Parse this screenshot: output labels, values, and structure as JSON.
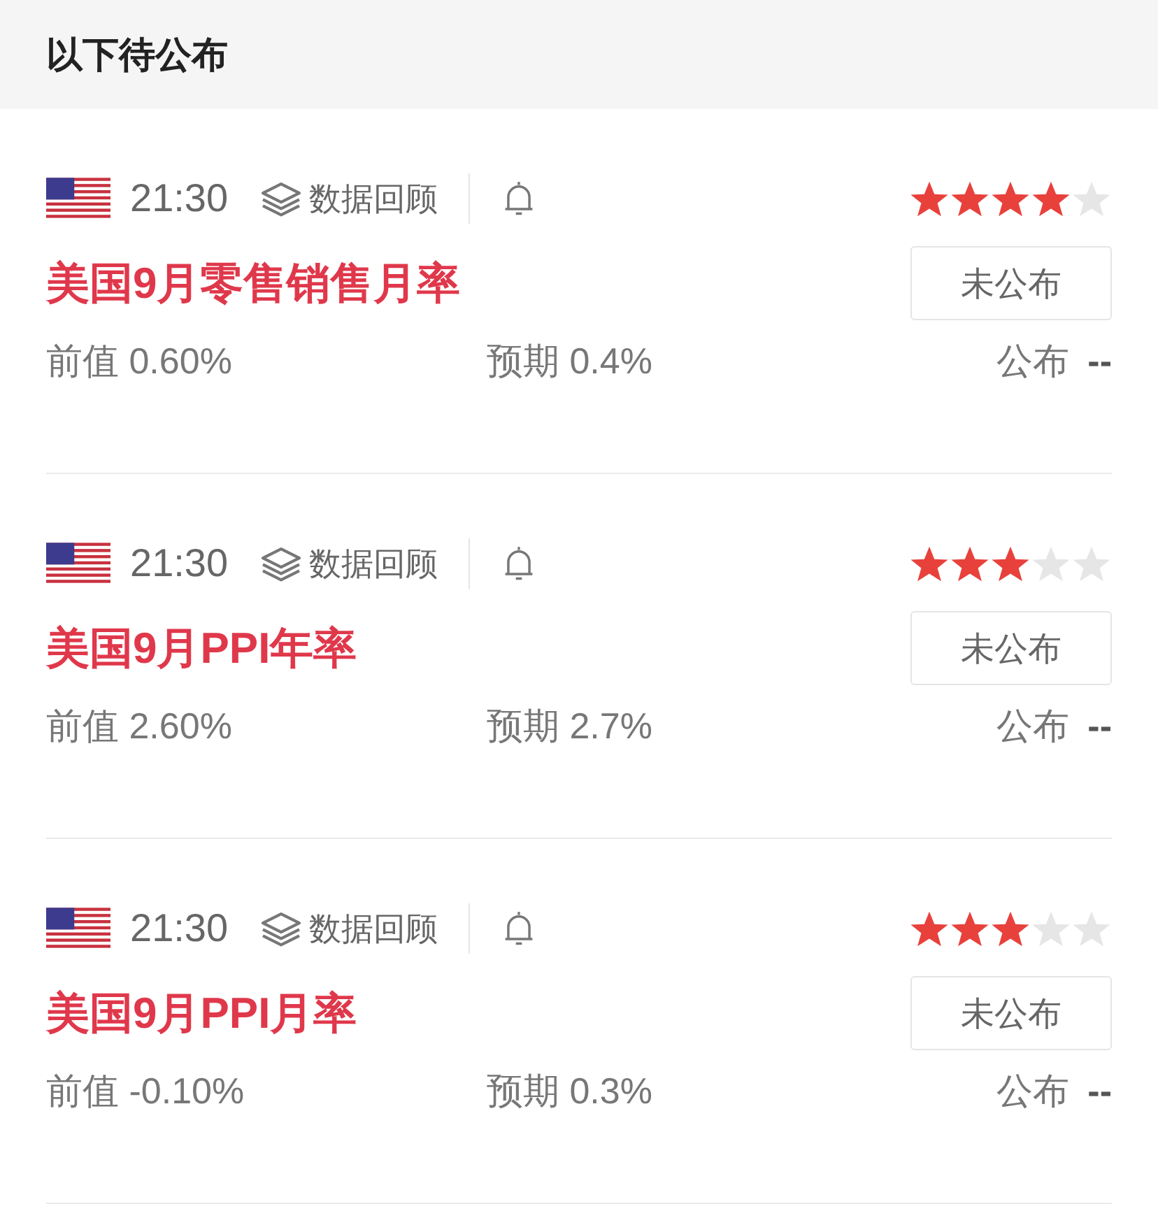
{
  "header": {
    "title": "以下待公布"
  },
  "events": [
    {
      "time": "21:30",
      "review": "数据回顾",
      "stars": 4,
      "title": "美国9月零售销售月率",
      "status": "未公布",
      "prev_label": "前值",
      "prev": "0.60%",
      "forecast_label": "预期",
      "forecast": "0.4%",
      "actual_label": "公布",
      "actual": "--"
    },
    {
      "time": "21:30",
      "review": "数据回顾",
      "stars": 3,
      "title": "美国9月PPI年率",
      "status": "未公布",
      "prev_label": "前值",
      "prev": "2.60%",
      "forecast_label": "预期",
      "forecast": "2.7%",
      "actual_label": "公布",
      "actual": "--"
    },
    {
      "time": "21:30",
      "review": "数据回顾",
      "stars": 3,
      "title": "美国9月PPI月率",
      "status": "未公布",
      "prev_label": "前值",
      "prev": "-0.10%",
      "forecast_label": "预期",
      "forecast": "0.3%",
      "actual_label": "公布",
      "actual": "--"
    }
  ]
}
